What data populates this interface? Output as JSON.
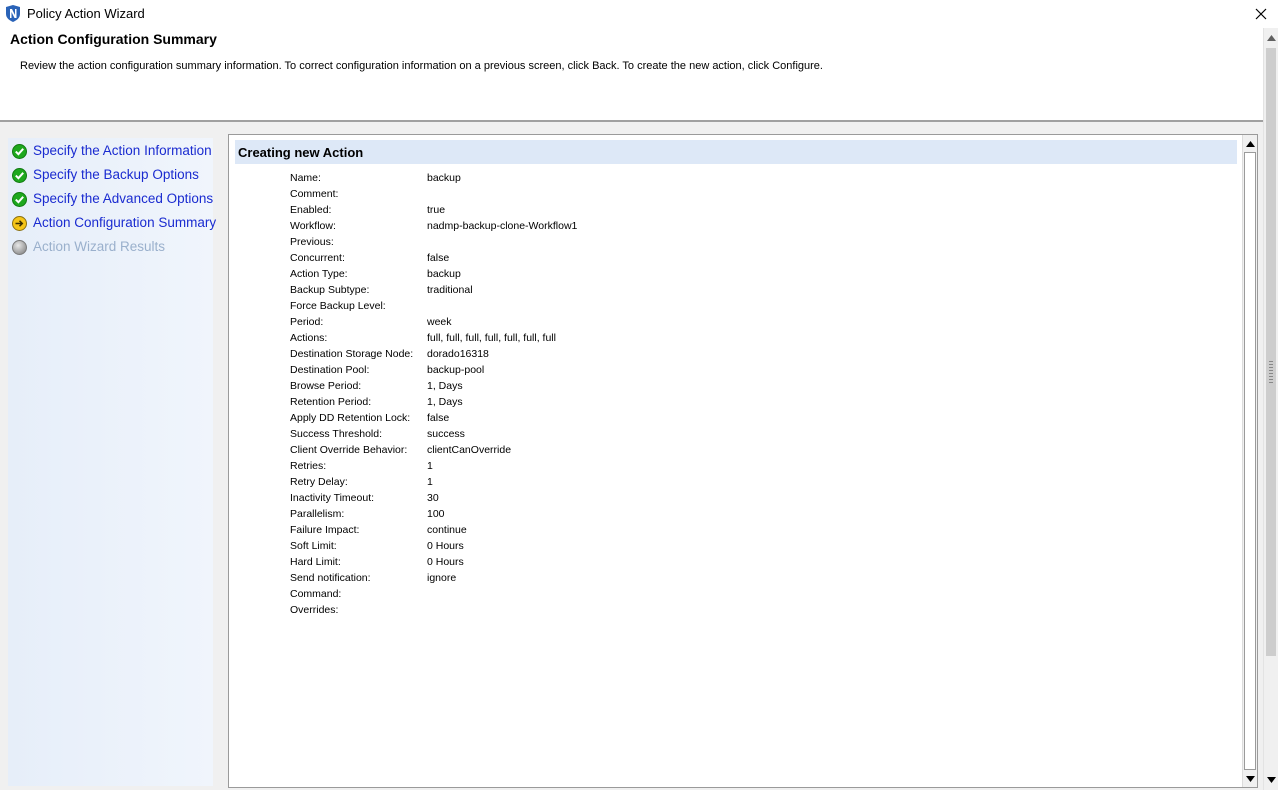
{
  "window": {
    "title": "Policy Action Wizard",
    "icon": "networker-n-logo-icon",
    "close_icon": "close-icon"
  },
  "header": {
    "title": "Action Configuration Summary",
    "description": "Review the action configuration summary information. To correct configuration information on a previous screen, click Back. To create the new action, click Configure."
  },
  "steps": [
    {
      "label": "Specify the Action Information",
      "status": "complete",
      "icon": "check-complete-icon"
    },
    {
      "label": "Specify the Backup Options",
      "status": "complete",
      "icon": "check-complete-icon"
    },
    {
      "label": "Specify the Advanced Options",
      "status": "complete",
      "icon": "check-complete-icon"
    },
    {
      "label": "Action Configuration Summary",
      "status": "current",
      "icon": "arrow-current-icon"
    },
    {
      "label": "Action Wizard Results",
      "status": "pending",
      "icon": "pending-circle-icon"
    }
  ],
  "summary": {
    "heading": "Creating new Action",
    "rows": [
      {
        "label": "Name:",
        "value": "backup"
      },
      {
        "label": "Comment:",
        "value": ""
      },
      {
        "label": "Enabled:",
        "value": "true"
      },
      {
        "label": "Workflow:",
        "value": "nadmp-backup-clone-Workflow1"
      },
      {
        "label": "Previous:",
        "value": ""
      },
      {
        "label": "Concurrent:",
        "value": "false"
      },
      {
        "label": "Action Type:",
        "value": "backup"
      },
      {
        "label": "Backup Subtype:",
        "value": "traditional"
      },
      {
        "label": "Force Backup Level:",
        "value": ""
      },
      {
        "label": "Period:",
        "value": "week"
      },
      {
        "label": "Actions:",
        "value": "full, full, full, full, full, full, full"
      },
      {
        "label": "Destination Storage Node:",
        "value": "dorado16318"
      },
      {
        "label": "Destination Pool:",
        "value": "backup-pool"
      },
      {
        "label": "Browse Period:",
        "value": "1, Days"
      },
      {
        "label": "Retention Period:",
        "value": "1, Days"
      },
      {
        "label": "Apply DD Retention Lock:",
        "value": "false"
      },
      {
        "label": "Success Threshold:",
        "value": "success"
      },
      {
        "label": "Client Override Behavior:",
        "value": "clientCanOverride"
      },
      {
        "label": "Retries:",
        "value": "1"
      },
      {
        "label": "Retry Delay:",
        "value": "1"
      },
      {
        "label": "Inactivity Timeout:",
        "value": "30"
      },
      {
        "label": "Parallelism:",
        "value": "100"
      },
      {
        "label": "Failure Impact:",
        "value": "continue"
      },
      {
        "label": "Soft Limit:",
        "value": "0 Hours"
      },
      {
        "label": "Hard Limit:",
        "value": "0 Hours"
      },
      {
        "label": "Send notification:",
        "value": "ignore"
      },
      {
        "label": "Command:",
        "value": ""
      },
      {
        "label": "Overrides:",
        "value": ""
      }
    ]
  },
  "colors": {
    "step_link": "#1a2bd0",
    "step_pending": "#9ab0cc",
    "complete_green": "#1ea81e",
    "current_yellow": "#f5c518",
    "header_band": "#dde8f7"
  }
}
